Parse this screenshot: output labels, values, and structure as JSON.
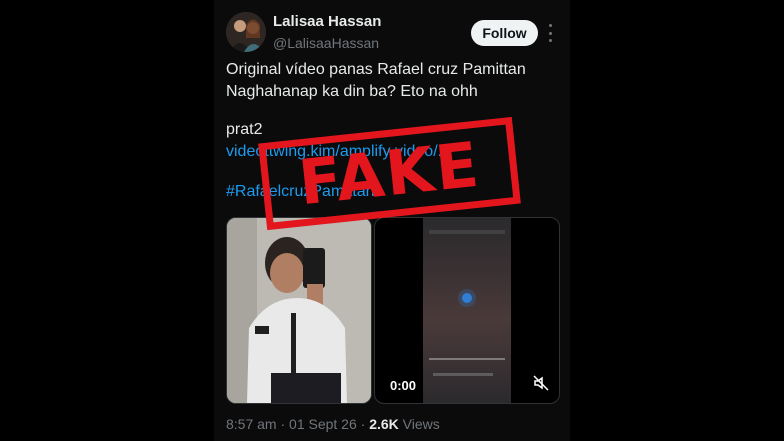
{
  "post": {
    "author_name": "Lalisaa Hassan",
    "author_handle": "@LalisaaHassan",
    "follow_label": "Follow",
    "text_line1": "Original vídeo panas Rafael cruz Pamittan",
    "text_line2": "Naghahanap ka din ba? Eto na ohh",
    "text_line3": "prat2",
    "link_text": "videottwing.kim/amplify video/...",
    "hashtag": "#RafaelcruzPamittan",
    "timestamp": "8:57 am · 01 Sept 26 · ",
    "views_count": "2.6K",
    "views_label": " Views"
  },
  "media": {
    "video_duration": "0:00"
  },
  "stamp": {
    "label": "FAKE",
    "color": "#e3151d"
  },
  "icons": {
    "more": "more-vertical-icon",
    "mute": "mute-icon"
  }
}
